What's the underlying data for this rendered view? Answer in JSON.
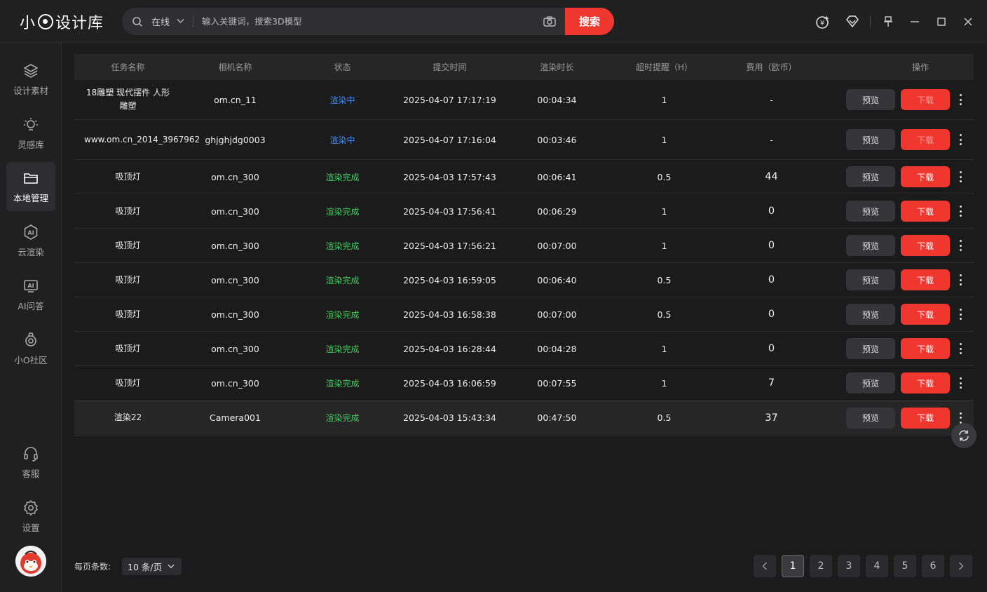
{
  "app": {
    "logo_text_left": "小",
    "logo_text_right": "设计库"
  },
  "search": {
    "scope": "在线",
    "placeholder": "输入关键词，搜索3D模型",
    "button": "搜索"
  },
  "sidebar": {
    "items": [
      {
        "label": "设计素材",
        "icon": "layers-icon"
      },
      {
        "label": "灵感库",
        "icon": "bulb-icon"
      },
      {
        "label": "本地管理",
        "icon": "folder-icon",
        "active": true
      },
      {
        "label": "云渲染",
        "icon": "ai-render-icon"
      },
      {
        "label": "AI问答",
        "icon": "ai-chat-icon"
      },
      {
        "label": "小O社区",
        "icon": "community-icon"
      }
    ],
    "bottom": [
      {
        "label": "客服",
        "icon": "headset-icon"
      },
      {
        "label": "设置",
        "icon": "gear-icon"
      }
    ]
  },
  "table": {
    "headers": [
      "任务名称",
      "相机名称",
      "状态",
      "提交时间",
      "渲染时长",
      "超时提醒（H）",
      "费用（欧币）",
      "操作"
    ],
    "preview_label": "预览",
    "download_label": "下载",
    "rows": [
      {
        "name": "18雕塑 现代摆件 人形雕塑",
        "camera": "om.cn_11",
        "status": "渲染中",
        "status_kind": "rendering",
        "submitted": "2025-04-07 17:17:19",
        "duration": "00:04:34",
        "timeout": "1",
        "fee": "-"
      },
      {
        "name": "www.om.cn_2014_3967962",
        "camera": "ghjghjdg0003",
        "status": "渲染中",
        "status_kind": "rendering",
        "submitted": "2025-04-07 17:16:04",
        "duration": "00:03:46",
        "timeout": "1",
        "fee": "-"
      },
      {
        "name": "吸顶灯",
        "camera": "om.cn_300",
        "status": "渲染完成",
        "status_kind": "done",
        "submitted": "2025-04-03 17:57:43",
        "duration": "00:06:41",
        "timeout": "0.5",
        "fee": "44"
      },
      {
        "name": "吸顶灯",
        "camera": "om.cn_300",
        "status": "渲染完成",
        "status_kind": "done",
        "submitted": "2025-04-03 17:56:41",
        "duration": "00:06:29",
        "timeout": "1",
        "fee": "0"
      },
      {
        "name": "吸顶灯",
        "camera": "om.cn_300",
        "status": "渲染完成",
        "status_kind": "done",
        "submitted": "2025-04-03 17:56:21",
        "duration": "00:07:00",
        "timeout": "1",
        "fee": "0"
      },
      {
        "name": "吸顶灯",
        "camera": "om.cn_300",
        "status": "渲染完成",
        "status_kind": "done",
        "submitted": "2025-04-03 16:59:05",
        "duration": "00:06:40",
        "timeout": "0.5",
        "fee": "0"
      },
      {
        "name": "吸顶灯",
        "camera": "om.cn_300",
        "status": "渲染完成",
        "status_kind": "done",
        "submitted": "2025-04-03 16:58:38",
        "duration": "00:07:00",
        "timeout": "0.5",
        "fee": "0"
      },
      {
        "name": "吸顶灯",
        "camera": "om.cn_300",
        "status": "渲染完成",
        "status_kind": "done",
        "submitted": "2025-04-03 16:28:44",
        "duration": "00:04:28",
        "timeout": "1",
        "fee": "0"
      },
      {
        "name": "吸顶灯",
        "camera": "om.cn_300",
        "status": "渲染完成",
        "status_kind": "done",
        "submitted": "2025-04-03 16:06:59",
        "duration": "00:07:55",
        "timeout": "1",
        "fee": "7"
      },
      {
        "name": "渲染22",
        "camera": "Camera001",
        "status": "渲染完成",
        "status_kind": "done",
        "submitted": "2025-04-03 15:43:34",
        "duration": "00:47:50",
        "timeout": "0.5",
        "fee": "37"
      }
    ]
  },
  "footer": {
    "page_size_label": "每页条数:",
    "page_size_value": "10 条/页",
    "pages": [
      "1",
      "2",
      "3",
      "4",
      "5",
      "6"
    ],
    "current_page": "1"
  },
  "colors": {
    "accent": "#f0372f",
    "rendering": "#3f8cf0",
    "done": "#3ccf5a",
    "background": "#1b1b1c"
  }
}
